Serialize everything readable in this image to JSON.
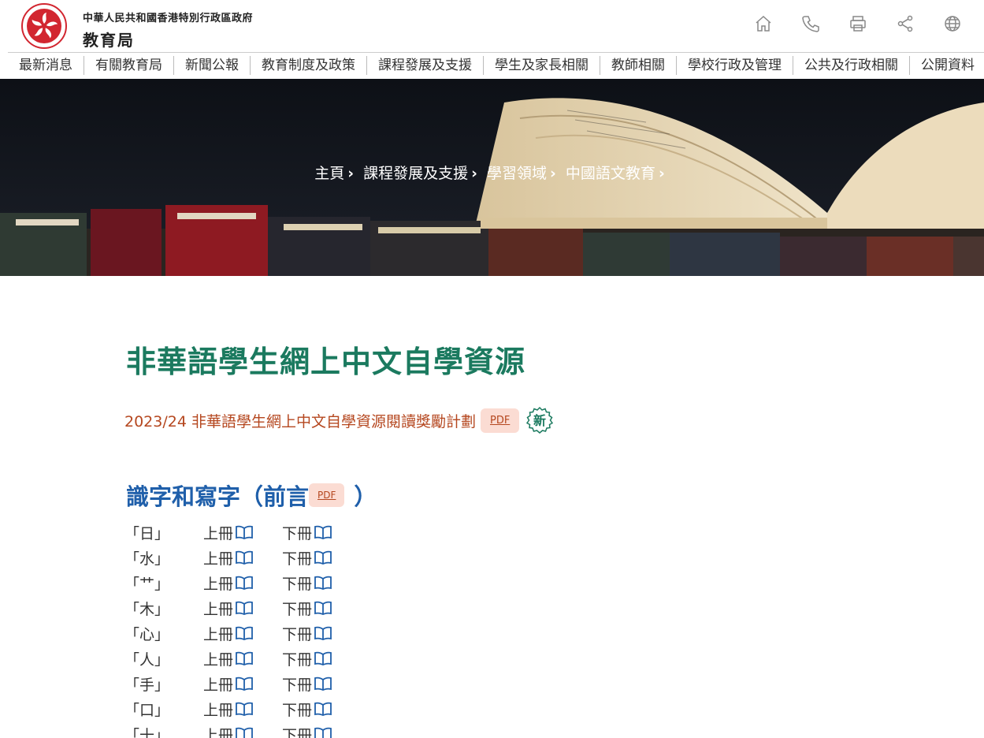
{
  "header": {
    "org_top": "中華人民共和國香港特別行政區政府",
    "org_main": "教育局",
    "tools": [
      {
        "name": "home-icon"
      },
      {
        "name": "phone-icon"
      },
      {
        "name": "print-icon"
      },
      {
        "name": "share-icon"
      },
      {
        "name": "globe-icon"
      }
    ]
  },
  "nav": {
    "items": [
      {
        "label": "最新消息"
      },
      {
        "label": "有關教育局"
      },
      {
        "label": "新聞公報"
      },
      {
        "label": "教育制度及政策"
      },
      {
        "label": "課程發展及支援"
      },
      {
        "label": "學生及家長相關"
      },
      {
        "label": "教師相關"
      },
      {
        "label": "學校行政及管理"
      },
      {
        "label": "公共及行政相關"
      },
      {
        "label": "公開資料"
      }
    ]
  },
  "breadcrumb": {
    "items": [
      {
        "label": "主頁"
      },
      {
        "label": "課程發展及支援"
      },
      {
        "label": "學習領域"
      },
      {
        "label": "中國語文教育"
      }
    ],
    "separator": "›"
  },
  "main": {
    "title": "非華語學生網上中文自學資源",
    "promo": {
      "label": "2023/24 非華語學生網上中文自學資源閱讀獎勵計劃",
      "pdf_label": "PDF",
      "new_badge": "新"
    },
    "section": {
      "title_prefix": "識字和寫字（前言",
      "pdf_label": "PDF",
      "title_suffix": "）"
    },
    "volume_labels": {
      "upper": "上冊",
      "lower": "下冊"
    },
    "rows": [
      {
        "character": "「日」"
      },
      {
        "character": "「水」"
      },
      {
        "character": "「艹」"
      },
      {
        "character": "「木」"
      },
      {
        "character": "「心」"
      },
      {
        "character": "「人」"
      },
      {
        "character": "「手」"
      },
      {
        "character": "「口」"
      },
      {
        "character": "「十」"
      }
    ]
  },
  "colors": {
    "title_green": "#1b7a5f",
    "link_orange": "#b5471f",
    "section_blue": "#1f5faa",
    "pdf_bg": "#fbdcd3"
  }
}
